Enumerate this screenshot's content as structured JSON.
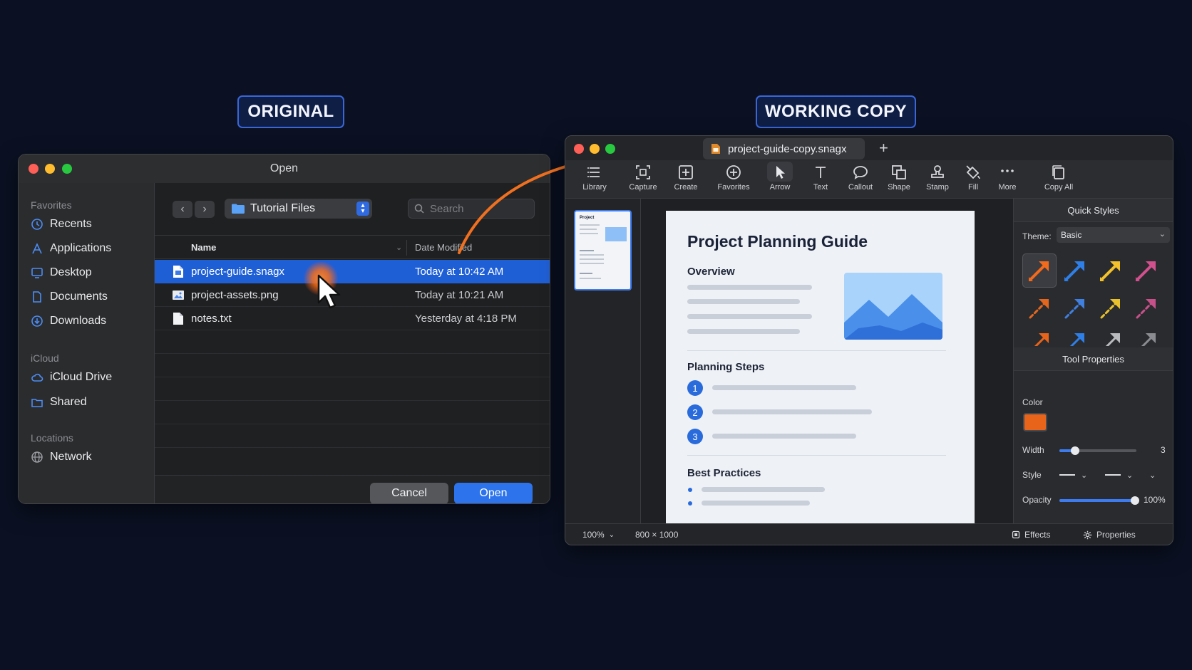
{
  "labels": {
    "original": "ORIGINAL",
    "working_copy": "WORKING COPY"
  },
  "open_dialog": {
    "title": "Open",
    "sidebar": {
      "favorites_heading": "Favorites",
      "favorites": [
        {
          "label": "Recents",
          "icon": "clock-icon"
        },
        {
          "label": "Applications",
          "icon": "applications-icon"
        },
        {
          "label": "Desktop",
          "icon": "desktop-icon"
        },
        {
          "label": "Documents",
          "icon": "document-icon"
        },
        {
          "label": "Downloads",
          "icon": "download-icon"
        }
      ],
      "icloud_heading": "iCloud",
      "icloud": [
        {
          "label": "iCloud Drive",
          "icon": "cloud-icon"
        },
        {
          "label": "Shared",
          "icon": "shared-folder-icon"
        }
      ],
      "locations_heading": "Locations",
      "locations": [
        {
          "label": "Network",
          "icon": "globe-icon"
        }
      ]
    },
    "current_folder": "Tutorial Files",
    "search_placeholder": "Search",
    "columns": {
      "name": "Name",
      "date": "Date Modified"
    },
    "files": [
      {
        "name": "project-guide.snagx",
        "date": "Today at 10:42 AM",
        "selected": true,
        "icon": "document-icon"
      },
      {
        "name": "project-assets.png",
        "date": "Today at 10:21 AM",
        "selected": false,
        "icon": "image-icon"
      },
      {
        "name": "notes.txt",
        "date": "Yesterday at 4:18 PM",
        "selected": false,
        "icon": "text-file-icon"
      }
    ],
    "buttons": {
      "cancel": "Cancel",
      "open": "Open"
    }
  },
  "editor": {
    "tab_title": "project-guide-copy.snagx",
    "toolbar": [
      {
        "label": "Library",
        "icon": "list-icon"
      },
      {
        "label": "Capture",
        "icon": "capture-icon"
      },
      {
        "label": "Create",
        "icon": "create-icon"
      },
      {
        "label": "Favorites",
        "icon": "favorites-icon"
      },
      {
        "label": "Arrow",
        "icon": "pointer-icon"
      },
      {
        "label": "Text",
        "icon": "text-icon"
      },
      {
        "label": "Callout",
        "icon": "callout-icon"
      },
      {
        "label": "Shape",
        "icon": "shape-icon"
      },
      {
        "label": "Stamp",
        "icon": "stamp-icon"
      },
      {
        "label": "Fill",
        "icon": "fill-icon"
      },
      {
        "label": "More",
        "icon": "more-icon"
      },
      {
        "label": "Copy All",
        "icon": "copy-icon"
      }
    ],
    "thumbnail_title": "Project",
    "document": {
      "title": "Project Planning Guide",
      "overview": "Overview",
      "planning_steps": "Planning Steps",
      "steps": [
        "1",
        "2",
        "3"
      ],
      "best_practices": "Best Practices"
    },
    "quick_styles": {
      "heading": "Quick Styles",
      "theme_label": "Theme:",
      "theme_value": "Basic",
      "arrow_colors": [
        "#f26a1b",
        "#2f7fe8",
        "#f3c12b",
        "#d2508e",
        "#e3661f",
        "#3f7fe0",
        "#e9c12d",
        "#c8508a",
        "#e8641b",
        "#2f7fe8",
        "#b9bbbf",
        "#8a8c91"
      ]
    },
    "tool_properties": {
      "heading": "Tool Properties",
      "color_label": "Color",
      "color_value": "#e8641b",
      "width_label": "Width",
      "width_value": "3",
      "width_fraction": 0.2,
      "style_label": "Style",
      "opacity_label": "Opacity",
      "opacity_value": "100%",
      "opacity_fraction": 1.0
    },
    "status": {
      "zoom": "100%",
      "dimensions": "800 × 1000",
      "effects": "Effects",
      "properties": "Properties"
    }
  },
  "colors": {
    "accent_blue": "#2d74ec",
    "accent_orange": "#f07020",
    "background": "#0b1123"
  }
}
